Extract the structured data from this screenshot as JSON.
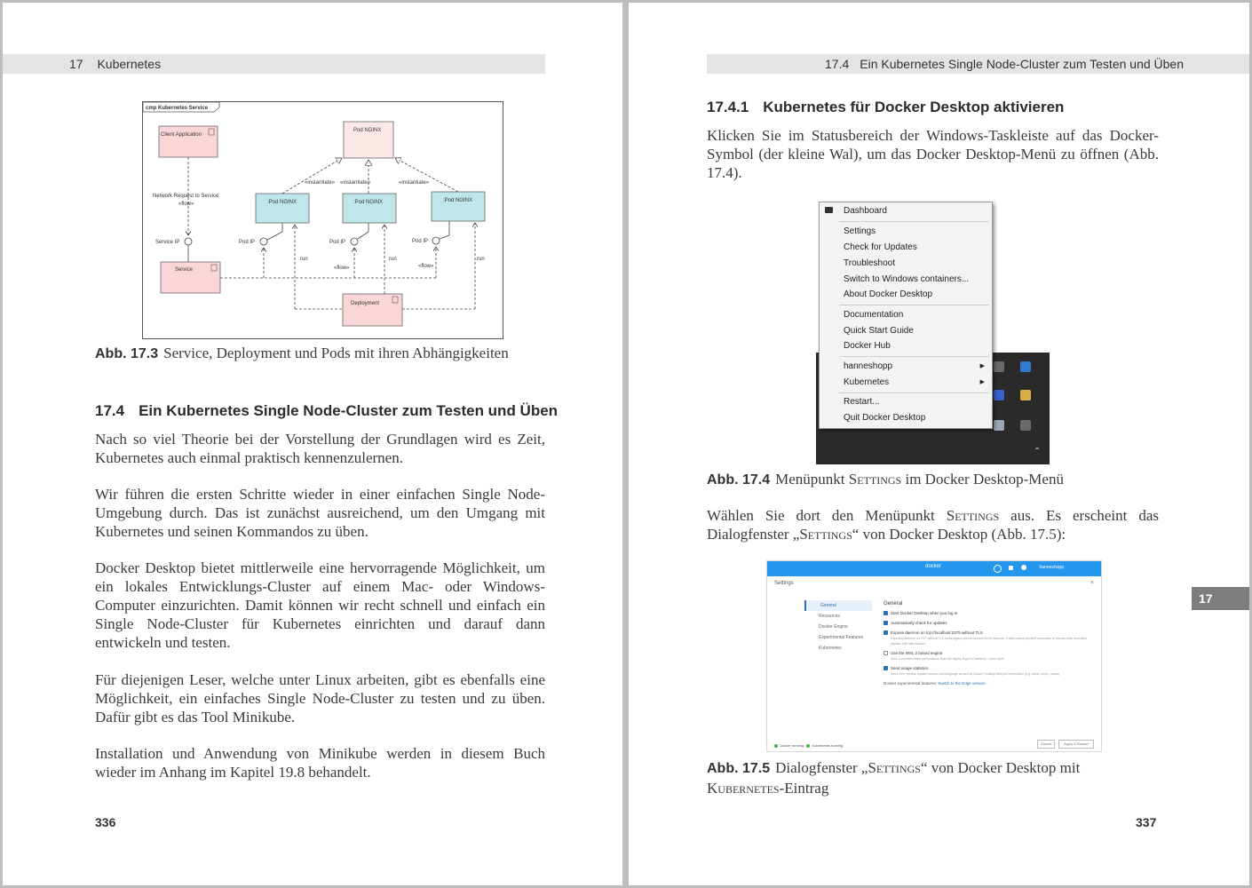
{
  "left": {
    "running_head": {
      "num": "17",
      "title": "Kubernetes"
    },
    "figure_uml": {
      "frame_label": "cmp Kubernetes Service",
      "client": "Client Application",
      "pod_top": "Pod NGINX",
      "pod1": ":Pod NGINX",
      "pod2": ":Pod NGINX",
      "pod3": ":Pod NGINX",
      "service": "Service",
      "deployment": "Deployment",
      "network_request": "Network Request to Service",
      "flow": "«flow»",
      "instantiate": "«instantiate»",
      "service_ip": "Service IP",
      "pod_ip": "Pod IP",
      "run": "run"
    },
    "caption1": {
      "label": "Abb. 17.3",
      "text": "Service, Deployment und Pods mit ihren Abhängigkeiten"
    },
    "section": {
      "num": "17.4",
      "title": "Ein Kubernetes Single Node-Cluster zum Testen und Üben"
    },
    "paragraphs": [
      "Nach so viel Theorie bei der Vorstellung der Grundlagen wird es Zeit, Kubernetes auch einmal praktisch kennenzulernen.",
      "Wir führen die ersten Schritte wieder in einer einfachen Single Node-Umgebung durch. Das ist zunächst ausreichend, um den Umgang mit Kubernetes und seinen Kommandos zu üben.",
      "Docker Desktop bietet mittlerweile eine hervorragende Möglichkeit, um ein lokales Entwicklungs-Cluster auf einem Mac- oder Windows-Computer einzurichten. Damit können wir recht schnell und einfach ein Single Node-Cluster für Kubernetes einrichten und darauf dann entwickeln und testen.",
      "Für diejenigen Leser, welche unter Linux arbeiten, gibt es ebenfalls eine Möglichkeit, ein einfaches Single Node-Cluster zu testen und zu üben. Dafür gibt es das Tool Minikube.",
      "Installation und Anwendung von Minikube werden in diesem Buch wieder im Anhang im Kapitel 19.8 behandelt."
    ],
    "folio": "336"
  },
  "right": {
    "running_head": {
      "num": "17.4",
      "title": "Ein Kubernetes Single Node-Cluster zum Testen und Üben"
    },
    "section": {
      "num": "17.4.1",
      "title": "Kubernetes für Docker Desktop aktivieren"
    },
    "para1": "Klicken Sie im Statusbereich der Windows-Taskleiste auf das Docker-Symbol (der kleine Wal), um das Docker Desktop-Menü zu öffnen (Abb. 17.4).",
    "menu_items": {
      "dashboard": "Dashboard",
      "settings": "Settings",
      "check_updates": "Check for Updates",
      "troubleshoot": "Troubleshoot",
      "switch": "Switch to Windows containers...",
      "about": "About Docker Desktop",
      "documentation": "Documentation",
      "quick_start": "Quick Start Guide",
      "hub": "Docker Hub",
      "user": "hanneshopp",
      "kubernetes": "Kubernetes",
      "restart": "Restart...",
      "quit": "Quit Docker Desktop"
    },
    "caption2": {
      "label": "Abb. 17.4",
      "text_before": "Menüpunkt ",
      "text_sc": "Settings",
      "text_after": " im Docker Desktop-Menü"
    },
    "para2_before": "Wählen Sie dort den Menüpunkt ",
    "para2_sc": "Settings",
    "para2_mid": " aus. Es erscheint das Dialogfenster „",
    "para2_sc2": "Settings",
    "para2_after": "“ von Docker Desktop (Abb. 17.5):",
    "settings_window": {
      "logo": "docker",
      "user": "hanneshopp",
      "title": "Settings",
      "close": "×",
      "nav": [
        "General",
        "Resources",
        "Docker Engine",
        "Experimental Features",
        "Kubernetes"
      ],
      "heading": "General",
      "options": [
        {
          "label": "Start Docker Desktop when you log in",
          "desc": "",
          "checked": true
        },
        {
          "label": "Automatically check for updates",
          "desc": "",
          "checked": true
        },
        {
          "label": "Expose daemon on tcp://localhost:2375 without TLS",
          "desc": "Exposing daemon on TCP without TLS helps legacy clients connect to the daemon. It also makes yourself vulnerable to remote code execution attacks. Use with caution.",
          "checked": true
        },
        {
          "label": "Use the WSL 2 based engine",
          "desc": "WSL 2 provides better performance than the legacy Hyper-V backend. Learn more",
          "checked": false
        },
        {
          "label": "Send usage statistics",
          "desc": "Send error reports, system version and language as well as Docker Desktop lifecycle information (e.g. starts, stops, resets).",
          "checked": true
        }
      ],
      "link_before": "Docker experimental features: ",
      "link": "Switch to the Edge version.",
      "status": [
        "Docker running",
        "Kubernetes running"
      ],
      "btn_cancel": "Cancel",
      "btn_apply": "Apply & Restart"
    },
    "caption3": {
      "label": "Abb. 17.5",
      "text_before": "Dialogfenster „",
      "text_sc": "Settings",
      "text_mid": "“ von Docker Desktop mit",
      "text_sc2": "Kubernetes",
      "text_after": "-Eintrag"
    },
    "thumb_tab": "17",
    "folio": "337"
  }
}
